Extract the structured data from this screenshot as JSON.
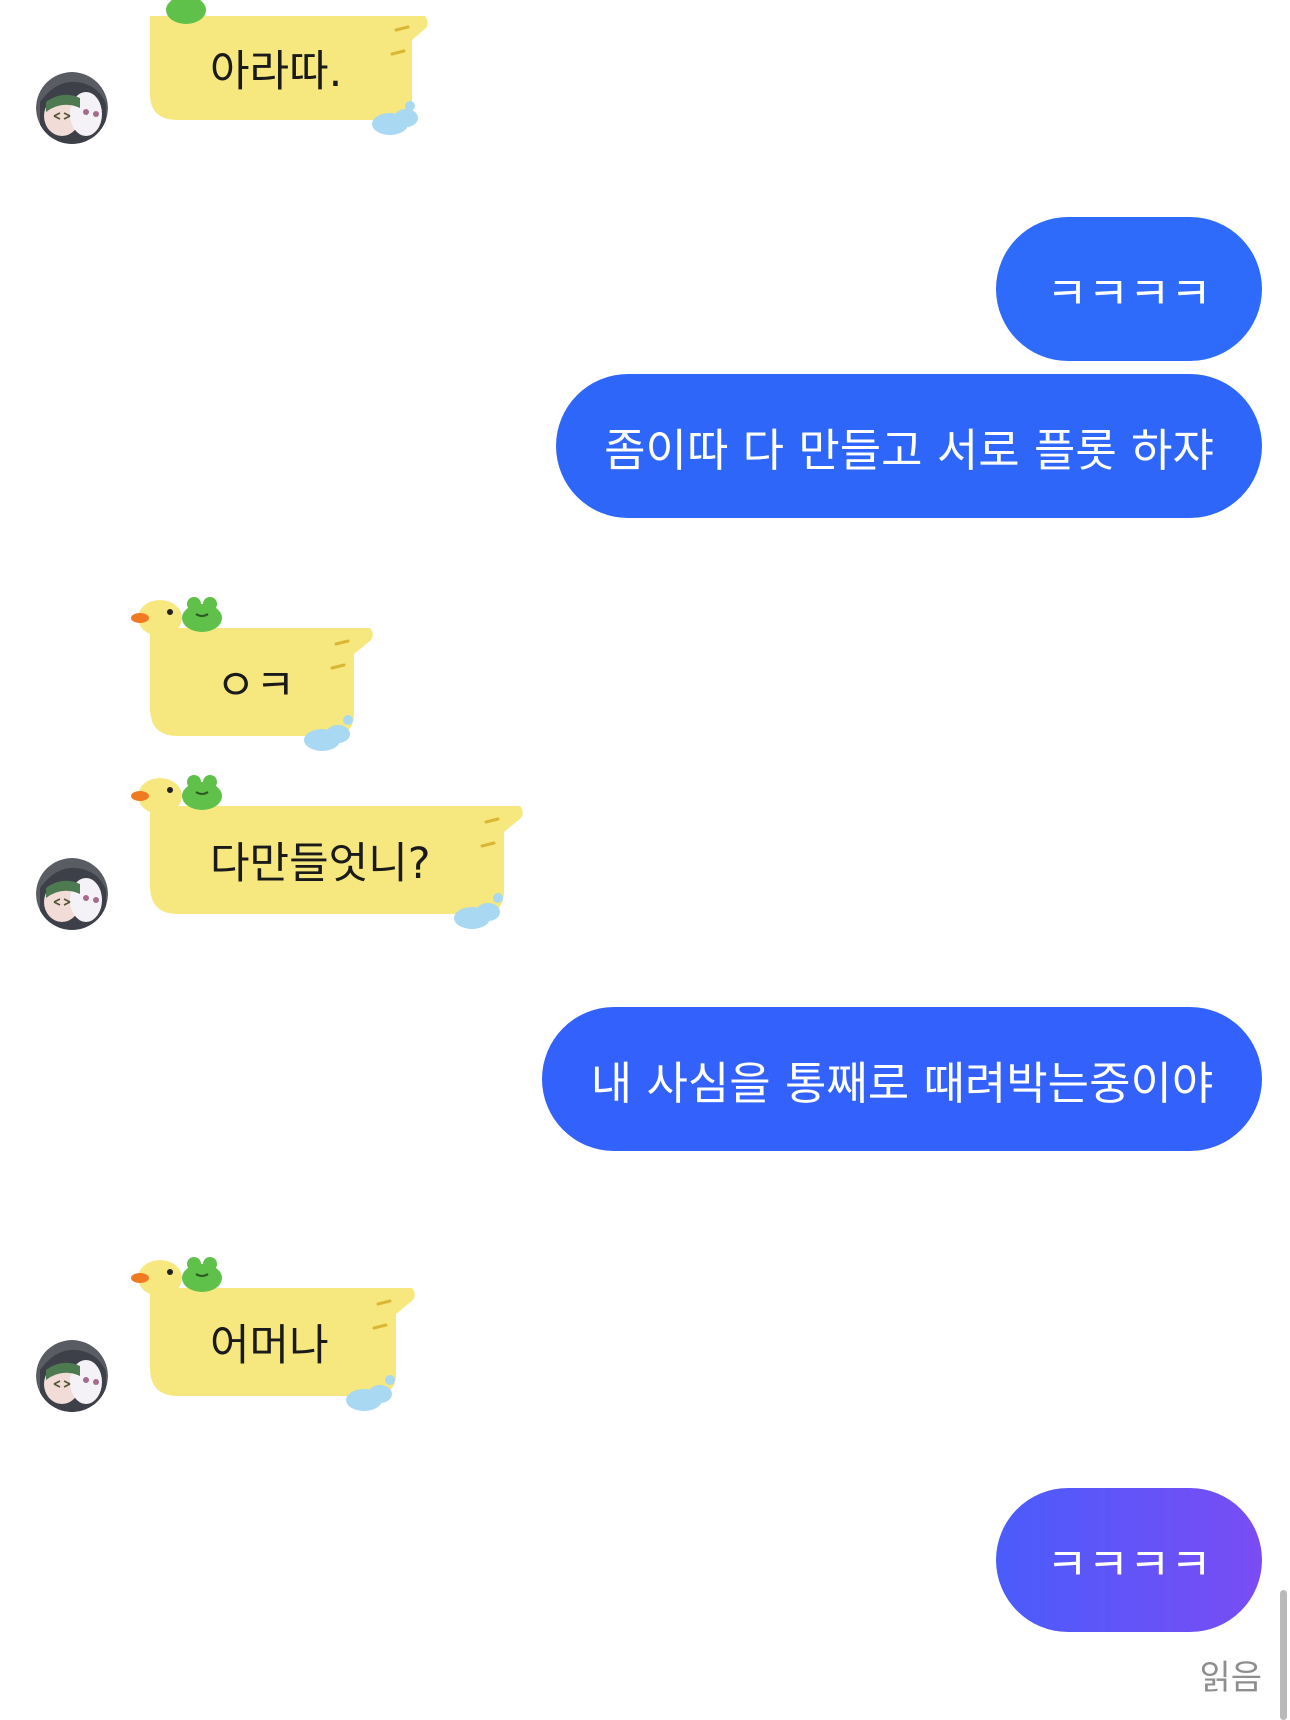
{
  "messages": [
    {
      "id": "m1",
      "from": "friend",
      "text": "아라따."
    },
    {
      "id": "m2",
      "from": "me",
      "text": "ㅋㅋㅋㅋ"
    },
    {
      "id": "m3",
      "from": "me",
      "text": "좀이따 다 만들고 서로 플롯 하쟈"
    },
    {
      "id": "m4",
      "from": "friend",
      "text": "ㅇㅋ"
    },
    {
      "id": "m5",
      "from": "friend",
      "text": "다만들엇니?"
    },
    {
      "id": "m6",
      "from": "me",
      "text": "내 사심을 통째로 때려박는중이야"
    },
    {
      "id": "m7",
      "from": "friend",
      "text": "어머나"
    },
    {
      "id": "m8",
      "from": "me",
      "text": "ㅋㅋㅋㅋ"
    }
  ],
  "read_receipt": "읽음",
  "colors": {
    "sent_bubble": "#2e6bfa",
    "sent_bubble_last_start": "#4a5cfb",
    "sent_bubble_last_end": "#7a4cf4",
    "duck_body": "#f6e87e",
    "frog": "#5fc04a",
    "bubble_cloud": "#a9d8f2"
  }
}
